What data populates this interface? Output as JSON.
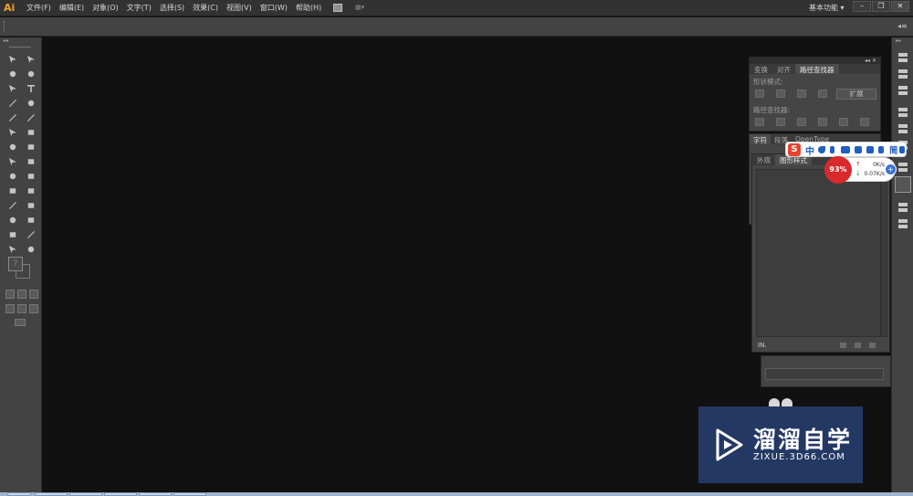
{
  "app": {
    "logo": "Ai"
  },
  "menu": [
    "文件(F)",
    "编辑(E)",
    "对象(O)",
    "文字(T)",
    "选择(S)",
    "效果(C)",
    "视图(V)",
    "窗口(W)",
    "帮助(H)"
  ],
  "workspace": {
    "label": "基本功能",
    "arrow": "▾"
  },
  "window_buttons": {
    "minimize": "–",
    "restore": "❐",
    "close": "✕"
  },
  "control_bar": {
    "menu_glyph": "◂≡"
  },
  "tools_panel": {
    "collapse_glyph": "◂◂",
    "unknown_color": "?"
  },
  "pathfinder_panel": {
    "header_glyph": "◂◂ ✕",
    "tabs": [
      "变换",
      "对齐",
      "路径查找器"
    ],
    "active_tab": 2,
    "shape_modes_label": "形状模式:",
    "pathfinders_label": "路径查找器:",
    "expand_button": "扩展"
  },
  "character_panel": {
    "tabs": [
      "字符",
      "段落",
      "OpenType"
    ],
    "active_tab": 0
  },
  "graphic_styles_panel": {
    "tabs": [
      "外观",
      "图形样式"
    ],
    "active_tab": 1,
    "library_menu": "IN."
  },
  "ime": {
    "logo": "S",
    "mode": "中",
    "simplified": "简"
  },
  "net_speed": {
    "cpu_percent": "93%",
    "upload": "0K/s",
    "download": "0.07K/s",
    "up_arrow": "↑",
    "down_arrow": "↓",
    "plus": "+"
  },
  "watermark": {
    "title": "溜溜自学",
    "subtitle": "ZIXUE.3D66.COM"
  },
  "colors": {
    "canvas": "#111111",
    "panel": "#434343",
    "menubar": "#323232",
    "logo_orange": "#f0a12a",
    "watermark_bg": "#243864",
    "ime_red": "#e8412c",
    "ime_blue": "#1f5fbf"
  }
}
